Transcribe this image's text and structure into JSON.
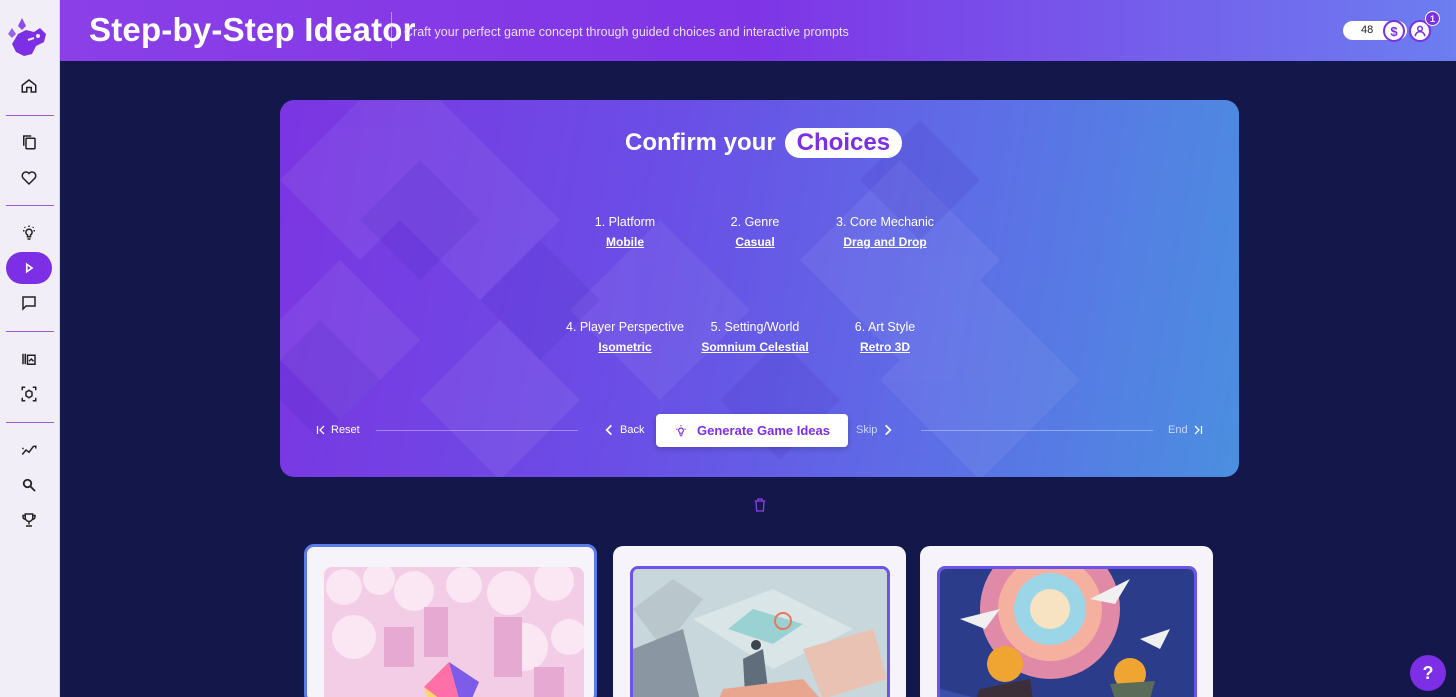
{
  "header": {
    "title": "Step-by-Step Ideator",
    "subtitle": "Craft your perfect game concept through guided choices and interactive prompts",
    "credits": "48",
    "notification_count": "1",
    "coin_symbol": "$"
  },
  "sidebar": {
    "items": [
      {
        "name": "home",
        "icon": "home-icon"
      },
      {
        "name": "copy",
        "icon": "copy-icon"
      },
      {
        "name": "favorites",
        "icon": "heart-icon"
      },
      {
        "name": "ideas",
        "icon": "lightbulb-icon"
      },
      {
        "name": "step-by-step",
        "icon": "play-icon",
        "active": true
      },
      {
        "name": "chat",
        "icon": "chat-icon"
      },
      {
        "name": "library",
        "icon": "library-icon"
      },
      {
        "name": "assets",
        "icon": "cube-icon"
      },
      {
        "name": "analytics",
        "icon": "trend-icon"
      },
      {
        "name": "search",
        "icon": "search-icon"
      },
      {
        "name": "trophy",
        "icon": "trophy-icon"
      }
    ]
  },
  "confirm": {
    "title_prefix": "Confirm your",
    "title_highlight": "Choices",
    "choices": [
      {
        "label": "1. Platform",
        "value": "Mobile"
      },
      {
        "label": "2. Genre",
        "value": "Casual"
      },
      {
        "label": "3. Core Mechanic",
        "value": "Drag and Drop"
      },
      {
        "label": "4. Player Perspective",
        "value": "Isometric"
      },
      {
        "label": "5. Setting/World",
        "value": "Somnium Celestial"
      },
      {
        "label": "6. Art Style",
        "value": "Retro 3D"
      }
    ],
    "controls": {
      "reset": "Reset",
      "back": "Back",
      "generate": "Generate Game Ideas",
      "skip": "Skip",
      "end": "End"
    }
  },
  "ideas": [
    {
      "name": "idea-card-1",
      "selected": true
    },
    {
      "name": "idea-card-2",
      "selected": false
    },
    {
      "name": "idea-card-3",
      "selected": false
    }
  ],
  "help": {
    "label": "?"
  },
  "colors": {
    "accent": "#7c2fe4",
    "background": "#13174a",
    "sidebar": "#f1eef7"
  }
}
